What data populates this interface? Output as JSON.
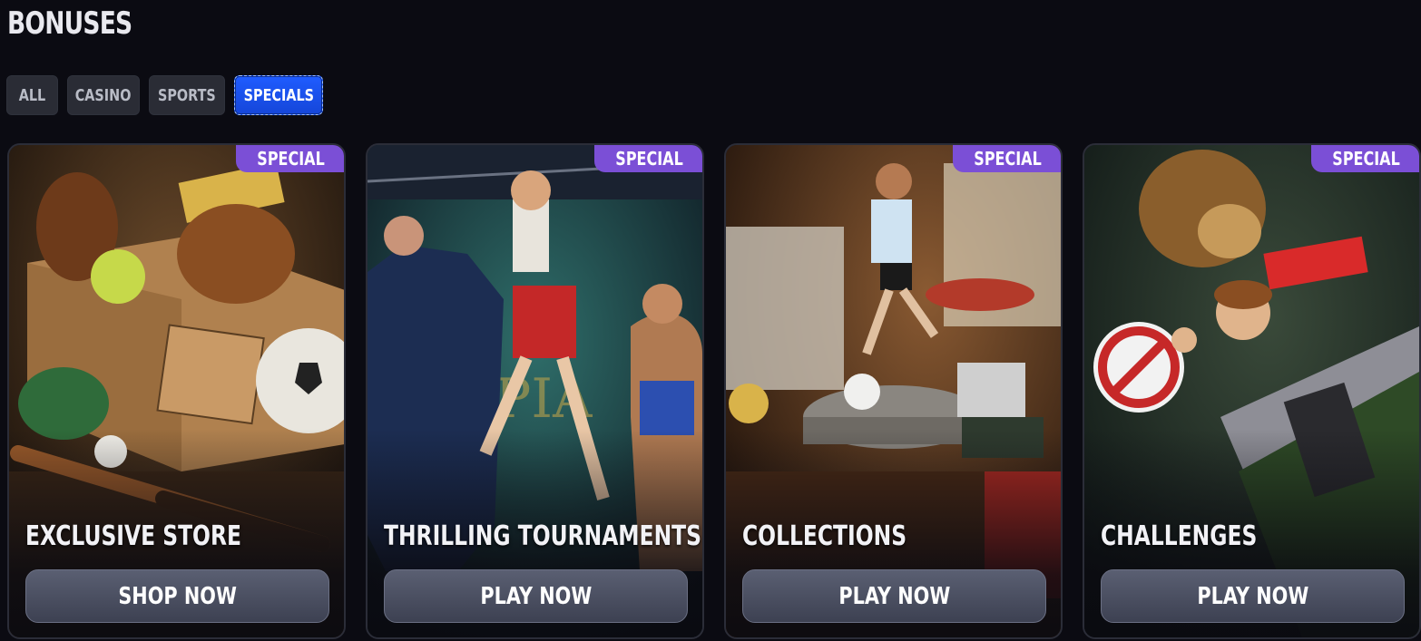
{
  "page": {
    "title": "BONUSES"
  },
  "filters": [
    {
      "label": "ALL",
      "active": false
    },
    {
      "label": "CASINO",
      "active": false
    },
    {
      "label": "SPORTS",
      "active": false
    },
    {
      "label": "SPECIALS",
      "active": true
    }
  ],
  "cards": [
    {
      "badge": "SPECIAL",
      "title": "EXCLUSIVE STORE",
      "button": "SHOP NOW",
      "art": "store-box-illustration"
    },
    {
      "badge": "SPECIAL",
      "title": "THRILLING TOURNAMENTS",
      "button": "PLAY NOW",
      "art": "boxer-stage-illustration"
    },
    {
      "badge": "SPECIAL",
      "title": "COLLECTIONS",
      "button": "PLAY NOW",
      "art": "footballer-figurine-illustration"
    },
    {
      "badge": "SPECIAL",
      "title": "CHALLENGES",
      "button": "PLAY NOW",
      "art": "lion-stadium-illustration"
    }
  ],
  "colors": {
    "accent": "#1f5cff",
    "badge": "#7b4fd6",
    "background": "#0b0b12"
  }
}
